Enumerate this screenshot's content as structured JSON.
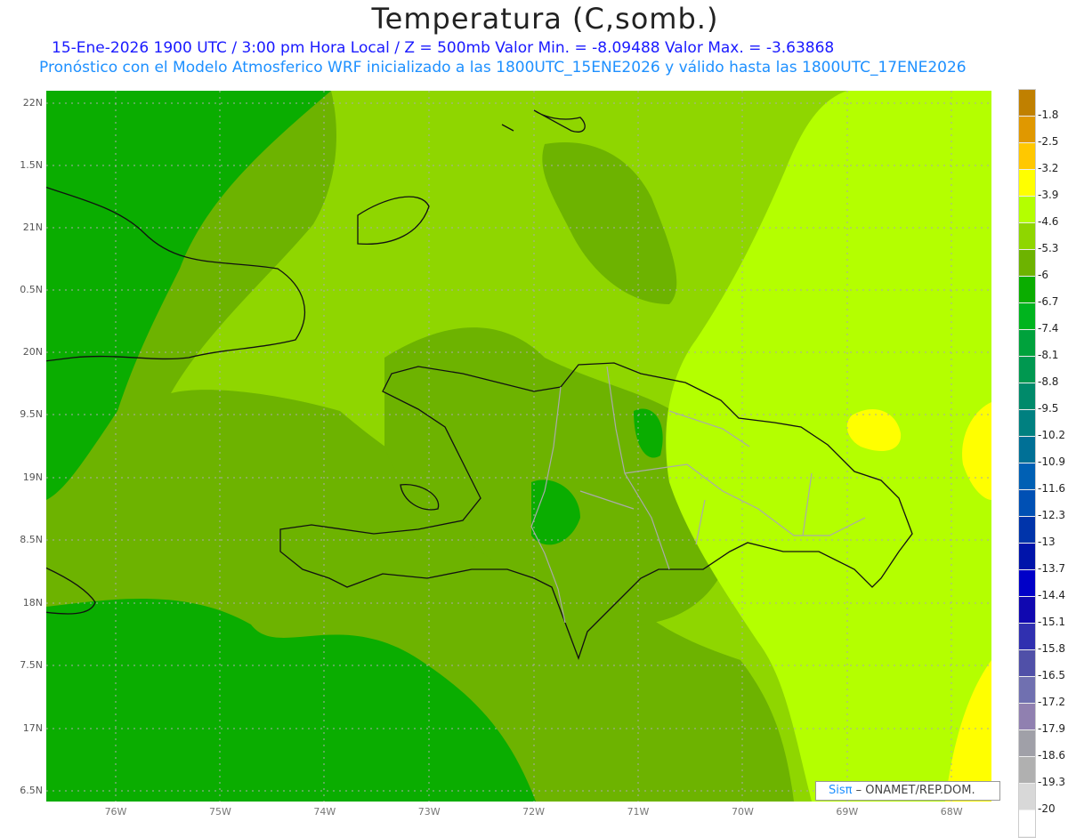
{
  "title": "Temperatura (C,somb.)",
  "subtitle1": "15-Ene-2026  1900 UTC / 3:00 pm Hora Local / Z = 500mb  Valor Min. = -8.09488  Valor Max. = -3.63868",
  "subtitle2": "Pronóstico con el Modelo Atmosferico WRF inicializado a las 1800UTC_15ENE2026 y válido hasta las  1800UTC_17ENE2026",
  "lat_labels": [
    "22N",
    "1.5N",
    "21N",
    "0.5N",
    "20N",
    "9.5N",
    "19N",
    "8.5N",
    "18N",
    "7.5N",
    "17N",
    "6.5N"
  ],
  "lon_labels": [
    "76W",
    "75W",
    "74W",
    "73W",
    "72W",
    "71W",
    "70W",
    "69W",
    "68W"
  ],
  "colorbar": {
    "colors": [
      "#c08000",
      "#e09800",
      "#ffc800",
      "#ffff00",
      "#b4ff00",
      "#8fd600",
      "#6db300",
      "#0aad00",
      "#00b41e",
      "#00a23c",
      "#009850",
      "#008a6a",
      "#008080",
      "#007096",
      "#0060b4",
      "#0050b4",
      "#0034aa",
      "#0014aa",
      "#0000c8",
      "#1008b0",
      "#3030b0",
      "#5050a8",
      "#7070b0",
      "#9080b0",
      "#a0a0a8",
      "#b0b0b0",
      "#d8d8d8",
      "#ffffff"
    ],
    "labels": [
      "-1.8",
      "-2.5",
      "-3.2",
      "-3.9",
      "-4.6",
      "-5.3",
      "-6",
      "-6.7",
      "-7.4",
      "-8.1",
      "-8.8",
      "-9.5",
      "-10.2",
      "-10.9",
      "-11.6",
      "-12.3",
      "-13",
      "-13.7",
      "-14.4",
      "-15.1",
      "-15.8",
      "-16.5",
      "-17.2",
      "-17.9",
      "-18.6",
      "-19.3",
      "-20"
    ]
  },
  "logo": {
    "brand": "Sisπ",
    "text": " –  ONAMET/REP.DOM."
  }
}
